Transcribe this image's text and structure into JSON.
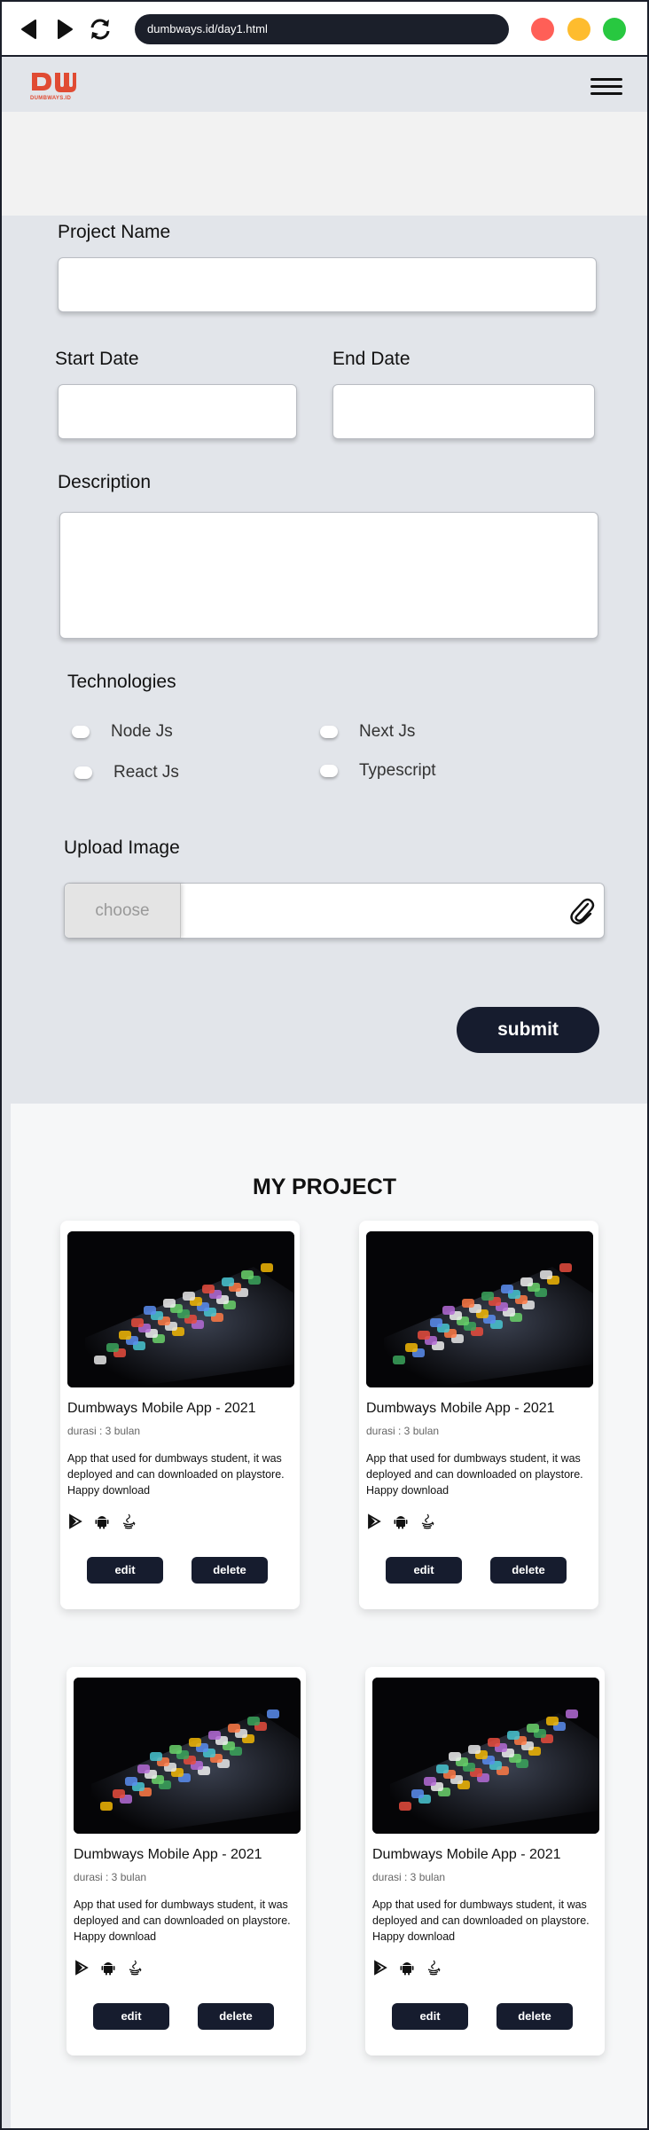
{
  "browser": {
    "url": "dumbways.id/day1.html",
    "traffic_lights": [
      "#ff5f57",
      "#febc2e",
      "#28c840"
    ]
  },
  "header": {
    "logo_text": "DUMBWAYS.ID",
    "menu_icon": "hamburger-icon"
  },
  "form": {
    "project_name_label": "Project Name",
    "start_date_label": "Start Date",
    "end_date_label": "End Date",
    "description_label": "Description",
    "technologies_label": "Technologies",
    "technologies": [
      "Node Js",
      "Next Js",
      "React Js",
      "Typescript"
    ],
    "upload_label": "Upload Image",
    "choose_label": "choose",
    "submit_label": "submit"
  },
  "projects": {
    "section_title": "MY PROJECT",
    "cards": [
      {
        "title": "Dumbways Mobile App - 2021",
        "duration": "durasi : 3 bulan",
        "description": "App that used for dumbways student, it was deployed and can downloaded on playstore. Happy download",
        "tech_icons": [
          "play-store-icon",
          "android-icon",
          "java-icon"
        ],
        "edit_label": "edit",
        "delete_label": "delete"
      },
      {
        "title": "Dumbways Mobile App - 2021",
        "duration": "durasi : 3 bulan",
        "description": "App that used for dumbways student, it was deployed and can downloaded on playstore. Happy download",
        "tech_icons": [
          "play-store-icon",
          "android-icon",
          "java-icon"
        ],
        "edit_label": "edit",
        "delete_label": "delete"
      },
      {
        "title": "Dumbways Mobile App - 2021",
        "duration": "durasi : 3 bulan",
        "description": "App that used for dumbways student, it was deployed and can downloaded on playstore. Happy download",
        "tech_icons": [
          "play-store-icon",
          "android-icon",
          "java-icon"
        ],
        "edit_label": "edit",
        "delete_label": "delete"
      },
      {
        "title": "Dumbways Mobile App - 2021",
        "duration": "durasi : 3 bulan",
        "description": "App that used for dumbways student, it was deployed and can downloaded on playstore. Happy download",
        "tech_icons": [
          "play-store-icon",
          "android-icon",
          "java-icon"
        ],
        "edit_label": "edit",
        "delete_label": "delete"
      }
    ]
  },
  "colors": {
    "brand": "#e04b33",
    "dark": "#161c2e",
    "form_bg": "#e2e5ea"
  }
}
